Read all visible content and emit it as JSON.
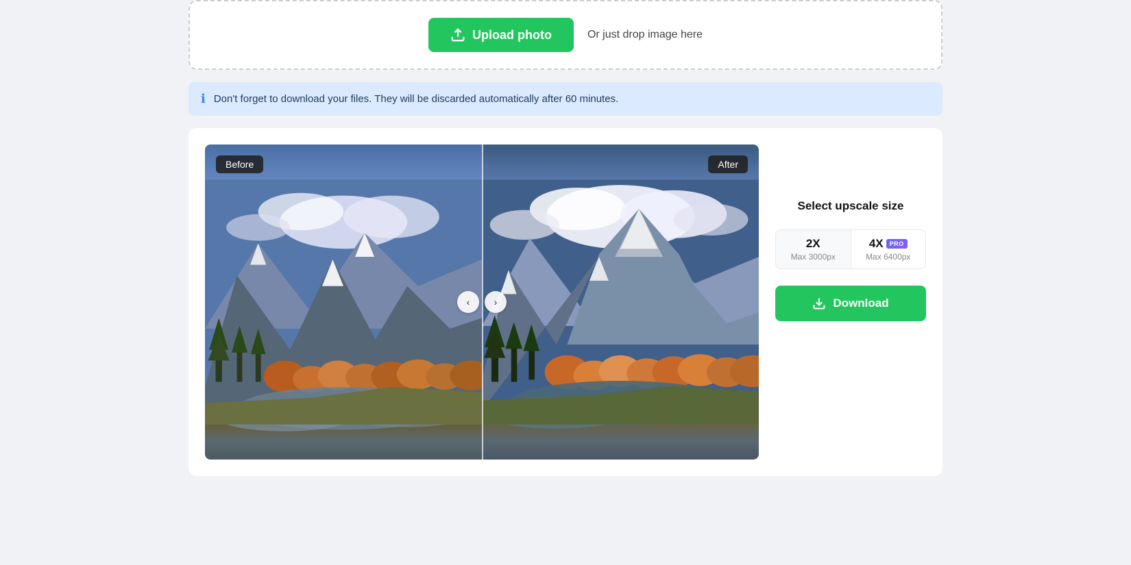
{
  "upload": {
    "btn_label": "Upload photo",
    "drop_text": "Or just drop image here"
  },
  "info": {
    "text": "Don't forget to download your files. They will be discarded automatically after 60 minutes."
  },
  "compare": {
    "before_label": "Before",
    "after_label": "After"
  },
  "panel": {
    "select_title": "Select upscale size",
    "option_2x_label": "2X",
    "option_2x_sub": "Max 3000px",
    "option_4x_label": "4X",
    "option_4x_sub": "Max 6400px",
    "pro_badge": "PRO",
    "download_label": "Download"
  },
  "arrows": {
    "left": "‹",
    "right": "›"
  },
  "colors": {
    "green": "#22c55e",
    "blue_info_bg": "#dbeafe",
    "pro_gradient_start": "#6366f1",
    "pro_gradient_end": "#8b5cf6"
  }
}
